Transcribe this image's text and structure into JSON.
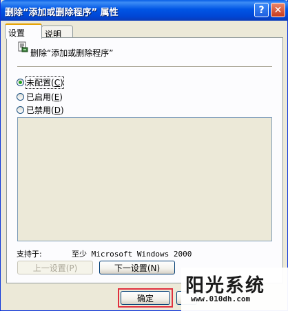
{
  "window": {
    "title": "删除“添加或删除程序” 属性",
    "help_glyph": "?",
    "close_glyph": "✕"
  },
  "tabs": [
    {
      "label": "设置",
      "active": true
    },
    {
      "label": "说明",
      "active": false
    }
  ],
  "policy": {
    "icon": "policy-setting-icon",
    "title": "删除“添加或删除程序”"
  },
  "options": [
    {
      "label": "未配置",
      "hotkey": "C",
      "checked": true
    },
    {
      "label": "已启用",
      "hotkey": "E",
      "checked": false
    },
    {
      "label": "已禁用",
      "hotkey": "D",
      "checked": false
    }
  ],
  "supported": {
    "label": "支持于:",
    "value": "至少 Microsoft Windows 2000"
  },
  "buttons": {
    "previous": "上一设置(P)",
    "next": "下一设置(N)",
    "ok": "确定"
  },
  "watermark": {
    "title": "阳光系统",
    "url": "www.010dh.com"
  },
  "colors": {
    "titlebar": "#0055E5",
    "highlight_border": "#E0303E",
    "radio_dot": "#21A121"
  }
}
